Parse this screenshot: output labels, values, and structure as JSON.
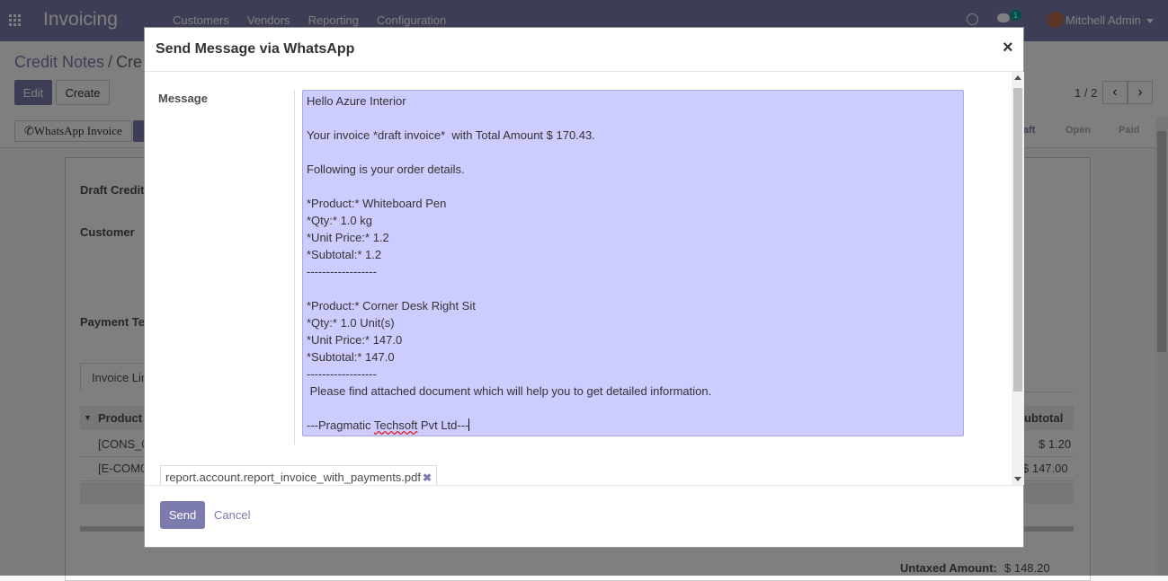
{
  "navbar": {
    "app_name": "Invoicing",
    "menu": [
      "Customers",
      "Vendors",
      "Reporting",
      "Configuration"
    ],
    "chat_badge": "1",
    "user": "Mitchell Admin"
  },
  "control": {
    "breadcrumb_parent": "Credit Notes",
    "breadcrumb_sep": "/",
    "breadcrumb_current": "Cre",
    "edit": "Edit",
    "create": "Create",
    "pager": "1 / 2"
  },
  "statusbar": {
    "whatsapp_button": "WhatsApp Invoice",
    "steps": [
      "aft",
      "Open",
      "Paid"
    ]
  },
  "form": {
    "draft_label": "Draft Credit",
    "customer_label": "Customer",
    "payment_terms_label": "Payment Te",
    "tab_invoice_lines": "Invoice Lin",
    "col_product": "Product",
    "col_subtotal": "ubtotal",
    "rows": [
      {
        "product": "[CONS_0",
        "subtotal": "$ 1.20"
      },
      {
        "product": "[E-COM0",
        "subtotal": "$ 147.00"
      }
    ],
    "untaxed_label": "Untaxed Amount:",
    "untaxed_value": "$ 148.20"
  },
  "modal": {
    "title": "Send Message via WhatsApp",
    "close": "×",
    "message_label": "Message",
    "message_lines": [
      "Hello Azure Interior",
      "",
      "Your invoice *draft invoice*  with Total Amount $ 170.43.",
      "",
      "Following is your order details.",
      "",
      "*Product:* Whiteboard Pen",
      "*Qty:* 1.0 kg",
      "*Unit Price:* 1.2",
      "*Subtotal:* 1.2",
      "------------------",
      "",
      "*Product:* Corner Desk Right Sit",
      "*Qty:* 1.0 Unit(s)",
      "*Unit Price:* 147.0",
      "*Subtotal:* 147.0",
      "------------------",
      " Please find attached document which will help you to get detailed information."
    ],
    "signature_prefix": "---Pragmatic ",
    "signature_word": "Techsoft",
    "signature_suffix": " Pvt Ltd---",
    "attachment": "report.account.report_invoice_with_payments.pdf",
    "send": "Send",
    "cancel": "Cancel"
  },
  "colors": {
    "brand": "#7c7bad",
    "message_background": "#ccccff"
  }
}
